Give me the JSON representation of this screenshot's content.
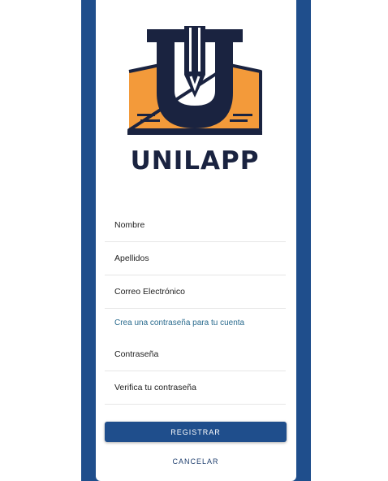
{
  "brand": {
    "name": "UNILAPP",
    "navy": "#1a2340",
    "orange": "#f39a3a",
    "frame_blue": "#1f4e8c"
  },
  "form": {
    "first_name": {
      "placeholder": "Nombre",
      "value": ""
    },
    "last_name": {
      "placeholder": "Apellidos",
      "value": ""
    },
    "email": {
      "placeholder": "Correo Electrónico",
      "value": ""
    },
    "password_hint": "Crea una contraseña para tu cuenta",
    "password": {
      "placeholder": "Contraseña",
      "value": ""
    },
    "password_confirm": {
      "placeholder": "Verifica tu contraseña",
      "value": ""
    }
  },
  "actions": {
    "register_label": "REGISTRAR",
    "cancel_label": "CANCELAR"
  },
  "icons": {
    "logo": "book-pen-logo-icon"
  }
}
